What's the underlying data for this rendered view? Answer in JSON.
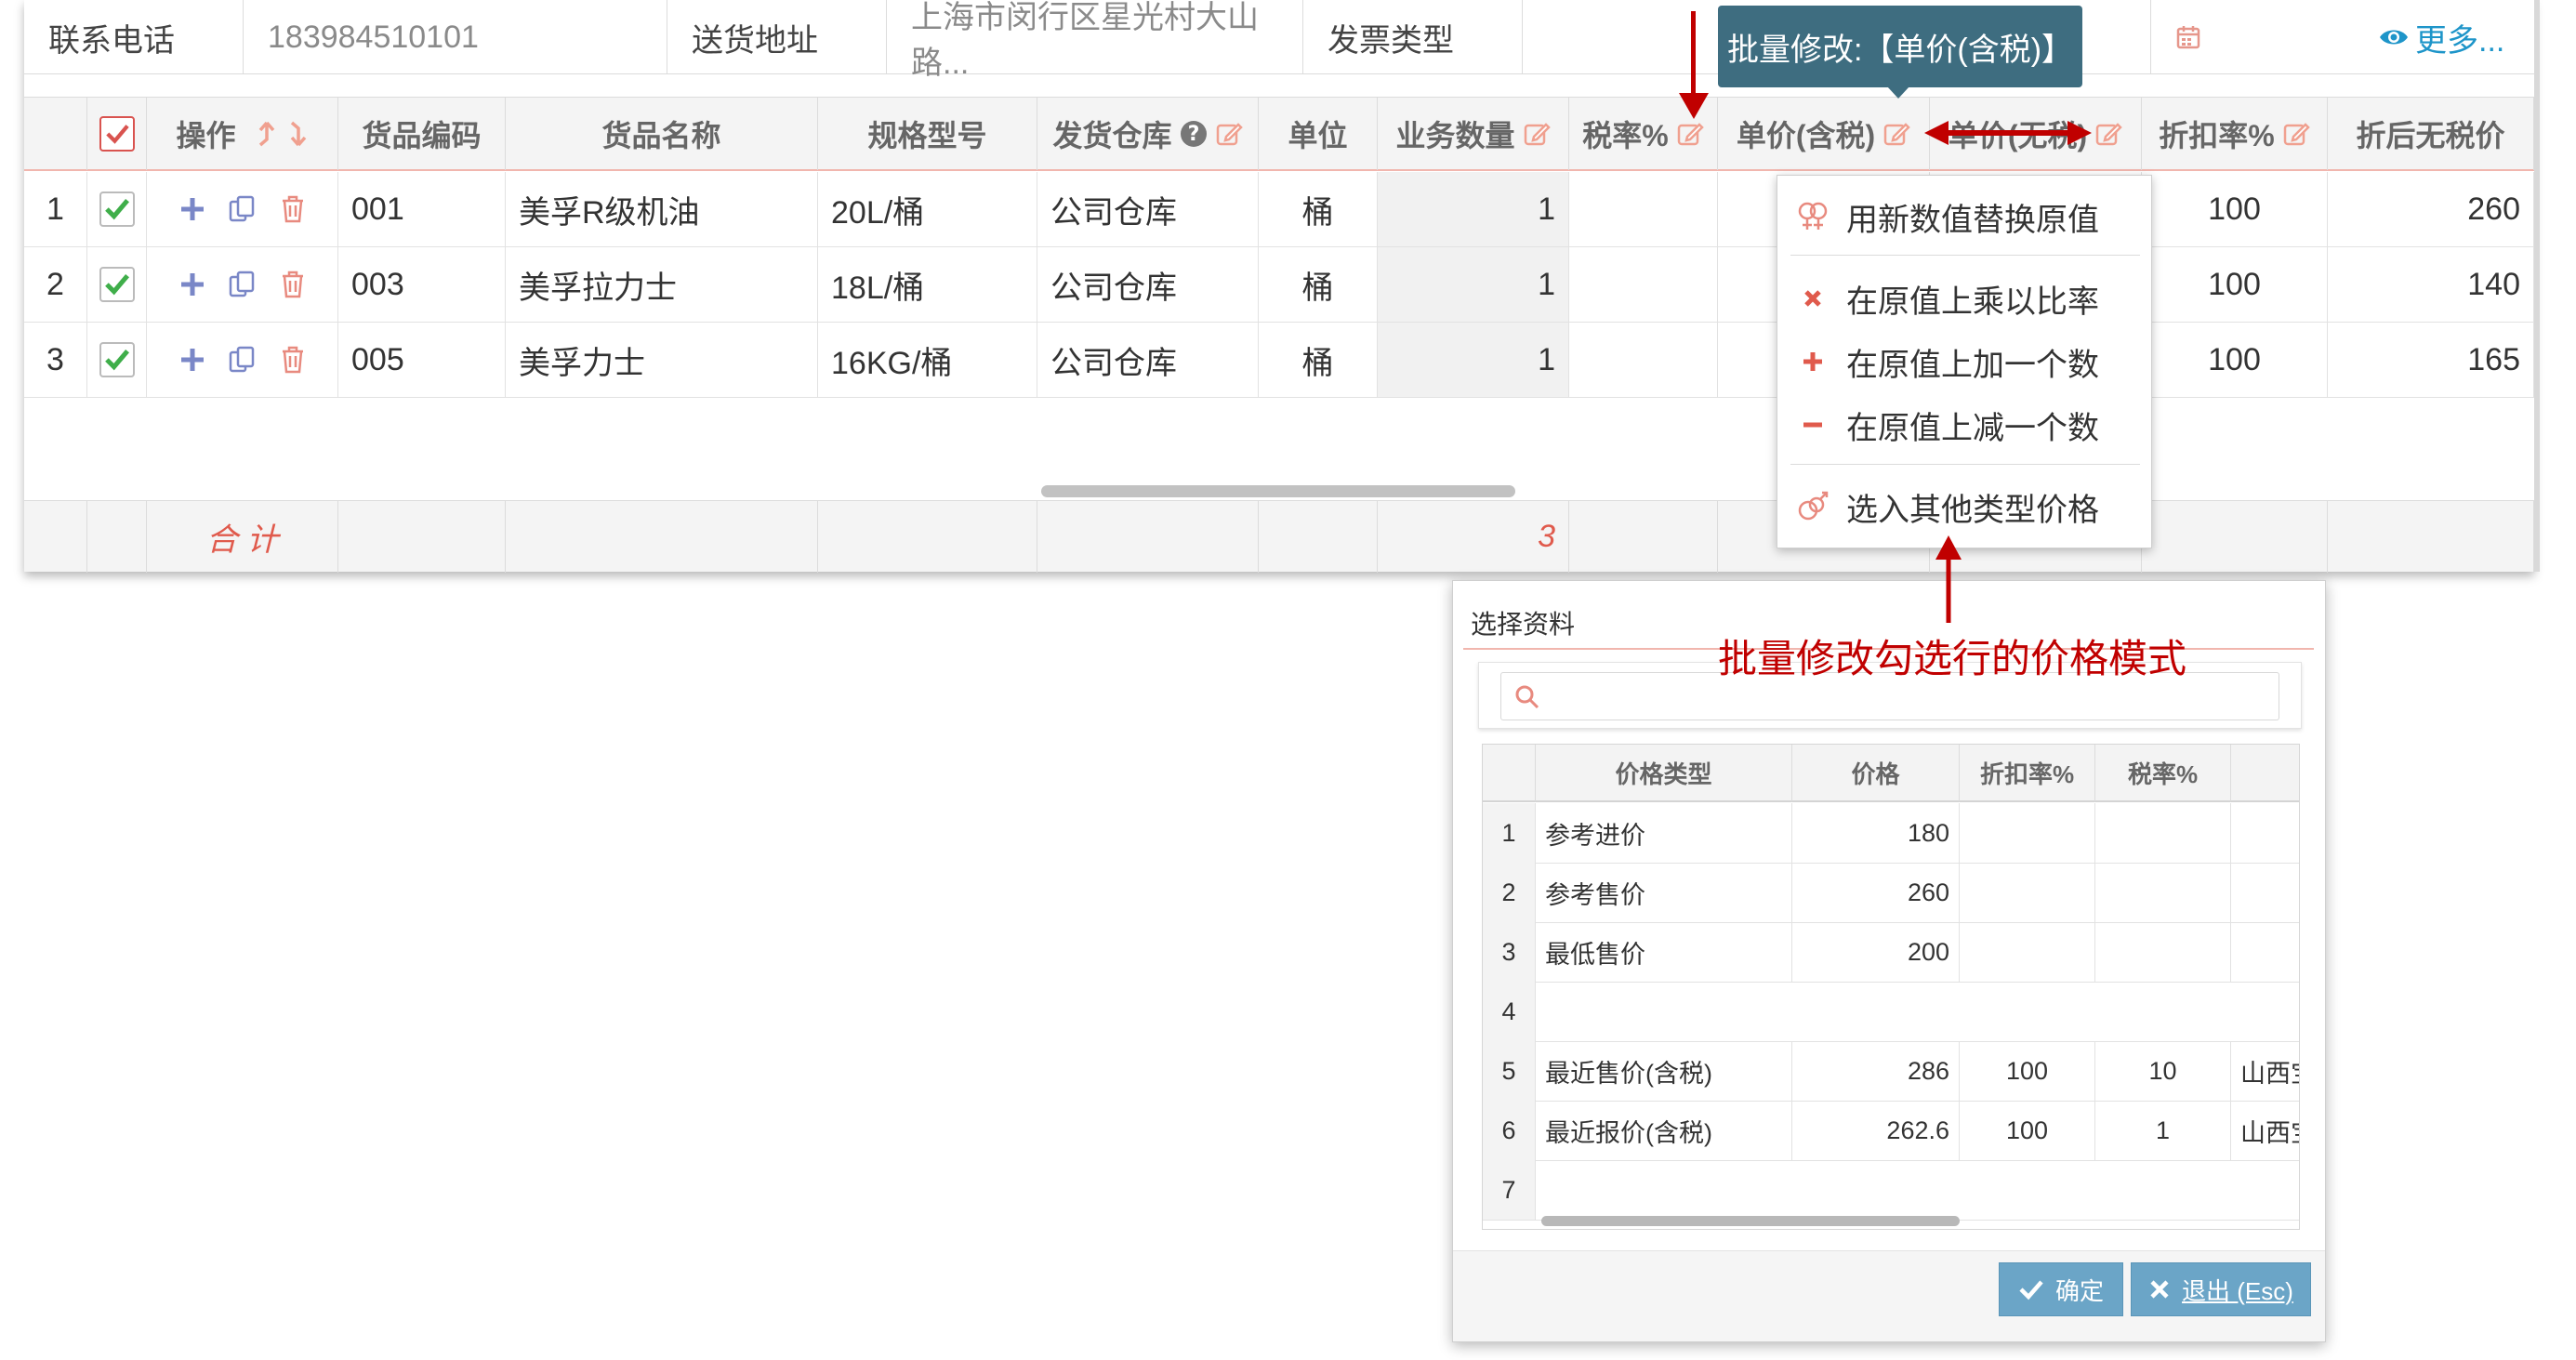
{
  "info": {
    "phone_label": "联系电话",
    "phone_value": "183984510101",
    "address_label": "送货地址",
    "address_value": "上海市闵行区星光村大山路...",
    "invoice_label": "发票类型",
    "more_label": "更多..."
  },
  "grid": {
    "headers": {
      "ops": "操作",
      "code": "货品编码",
      "name": "货品名称",
      "spec": "规格型号",
      "warehouse": "发货仓库",
      "unit": "单位",
      "qty": "业务数量",
      "tax_rate": "税率%",
      "price_tax": "单价(含税)",
      "price_notax": "单价(无税)",
      "discount": "折扣率%",
      "after_discount": "折后无税价"
    },
    "rows": [
      {
        "num": "1",
        "code": "001",
        "name": "美孚R级机油",
        "spec": "20L/桶",
        "warehouse": "公司仓库",
        "unit": "桶",
        "qty": "1",
        "discount": "100",
        "after_discount": "260"
      },
      {
        "num": "2",
        "code": "003",
        "name": "美孚拉力士",
        "spec": "18L/桶",
        "warehouse": "公司仓库",
        "unit": "桶",
        "qty": "1",
        "discount": "100",
        "after_discount": "140"
      },
      {
        "num": "3",
        "code": "005",
        "name": "美孚力士",
        "spec": "16KG/桶",
        "warehouse": "公司仓库",
        "unit": "桶",
        "qty": "1",
        "discount": "100",
        "after_discount": "165"
      }
    ],
    "footer": {
      "total_label": "合 计",
      "qty_total": "3"
    }
  },
  "tooltip": {
    "text": "批量修改:【单价(含税)】"
  },
  "context_menu": {
    "items": [
      {
        "label": "用新数值替换原值",
        "icon": "replace-icon"
      },
      {
        "label": "在原值上乘以比率",
        "icon": "multiply-icon"
      },
      {
        "label": "在原值上加一个数",
        "icon": "plus-icon"
      },
      {
        "label": "在原值上减一个数",
        "icon": "minus-icon"
      },
      {
        "label": "选入其他类型价格",
        "icon": "select-price-icon"
      }
    ]
  },
  "dialog": {
    "title": "选择资料",
    "search_placeholder": "",
    "headers": {
      "type": "价格类型",
      "price": "价格",
      "discount": "折扣率%",
      "tax": "税率%"
    },
    "rows": [
      {
        "num": "1",
        "type": "参考进价",
        "price": "180",
        "discount": "",
        "tax": "",
        "extra": ""
      },
      {
        "num": "2",
        "type": "参考售价",
        "price": "260",
        "discount": "",
        "tax": "",
        "extra": ""
      },
      {
        "num": "3",
        "type": "最低售价",
        "price": "200",
        "discount": "",
        "tax": "",
        "extra": ""
      },
      {
        "num": "4",
        "type": "",
        "price": "",
        "discount": "",
        "tax": "",
        "extra": ""
      },
      {
        "num": "5",
        "type": "最近售价(含税)",
        "price": "286",
        "discount": "100",
        "tax": "10",
        "extra": "山西宝"
      },
      {
        "num": "6",
        "type": "最近报价(含税)",
        "price": "262.6",
        "discount": "100",
        "tax": "1",
        "extra": "山西宝"
      },
      {
        "num": "7",
        "type": "",
        "price": "",
        "discount": "",
        "tax": "",
        "extra": ""
      }
    ],
    "ok_label": "确定",
    "cancel_label": "退出 (Esc)"
  },
  "annotation": {
    "text": "批量修改勾选行的价格模式"
  },
  "colors": {
    "accent_red": "#e05a4c",
    "annotation_red": "#c00000",
    "tooltip_bg": "#3e6d80",
    "button_blue": "#6ba5c7",
    "more_link": "#1e95c9"
  }
}
